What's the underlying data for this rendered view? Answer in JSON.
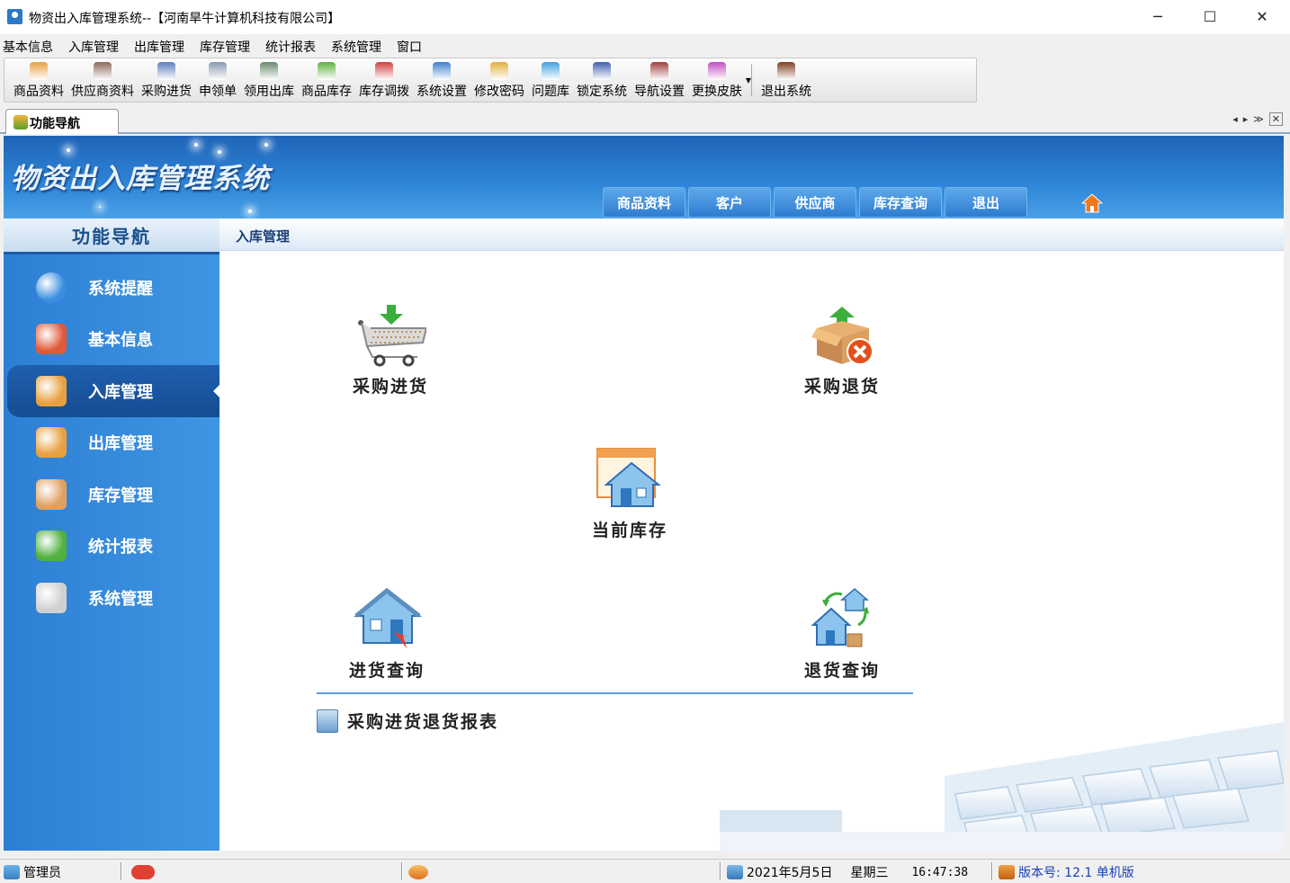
{
  "window": {
    "title": "物资出入库管理系统--【河南旱牛计算机科技有限公司】",
    "minimize": "─",
    "maximize": "☐",
    "close": "✕"
  },
  "menubar": [
    "基本信息",
    "入库管理",
    "出库管理",
    "库存管理",
    "统计报表",
    "系统管理",
    "窗口"
  ],
  "toolbar": [
    {
      "label": "商品资料",
      "icon": "goods-icon",
      "color": "#e8a040"
    },
    {
      "label": "供应商资料",
      "icon": "suppliers-icon",
      "color": "#8a6a5a"
    },
    {
      "label": "采购进货",
      "icon": "purchase-truck-icon",
      "color": "#5a7fc0"
    },
    {
      "label": "申领单",
      "icon": "requisition-form-icon",
      "color": "#8a9ab0"
    },
    {
      "label": "领用出库",
      "icon": "cart-out-icon",
      "color": "#6a8a6a"
    },
    {
      "label": "商品库存",
      "icon": "inventory-box-icon",
      "color": "#60b040"
    },
    {
      "label": "库存调拨",
      "icon": "transfer-arrows-icon",
      "color": "#d04040"
    },
    {
      "label": "系统设置",
      "icon": "settings-icon",
      "color": "#4080d0"
    },
    {
      "label": "修改密码",
      "icon": "key-icon",
      "color": "#e0b040"
    },
    {
      "label": "问题库",
      "icon": "help-bubble-icon",
      "color": "#40a0e0"
    },
    {
      "label": "锁定系统",
      "icon": "lock-screen-icon",
      "color": "#4060b0"
    },
    {
      "label": "导航设置",
      "icon": "nav-settings-icon",
      "color": "#a04040"
    },
    {
      "label": "更换皮肤",
      "icon": "skin-palette-icon",
      "color": "#c050c0"
    },
    {
      "label": "退出系统",
      "icon": "exit-door-icon",
      "color": "#804020"
    }
  ],
  "tab": {
    "label": "功能导航"
  },
  "banner": {
    "title": "物资出入库管理系统",
    "nav": [
      "商品资料",
      "客户",
      "供应商",
      "库存查询",
      "退出"
    ]
  },
  "sidebar": {
    "title": "功能导航",
    "items": [
      {
        "label": "系统提醒",
        "icon": "info-icon",
        "color": "#3a8ee0"
      },
      {
        "label": "基本信息",
        "icon": "cubes-icon",
        "color": "#e05a3a"
      },
      {
        "label": "入库管理",
        "icon": "box-in-icon",
        "color": "#e8a040",
        "active": true
      },
      {
        "label": "出库管理",
        "icon": "box-out-icon",
        "color": "#e8a040"
      },
      {
        "label": "库存管理",
        "icon": "warehouse-icon",
        "color": "#e0a060"
      },
      {
        "label": "统计报表",
        "icon": "bar-chart-icon",
        "color": "#50b040"
      },
      {
        "label": "系统管理",
        "icon": "tools-icon",
        "color": "#d0d0d0"
      }
    ]
  },
  "content": {
    "breadcrumb": "入库管理",
    "functions": {
      "purchase_in": "采购进货",
      "purchase_return": "采购退货",
      "current_stock": "当前库存",
      "purchase_query": "进货查询",
      "return_query": "退货查询"
    },
    "report_link": "采购进货退货报表"
  },
  "statusbar": {
    "user": "管理员",
    "date": "2021年5月5日",
    "weekday": "星期三",
    "time": "16:47:38",
    "version": "版本号: 12.1 单机版"
  }
}
